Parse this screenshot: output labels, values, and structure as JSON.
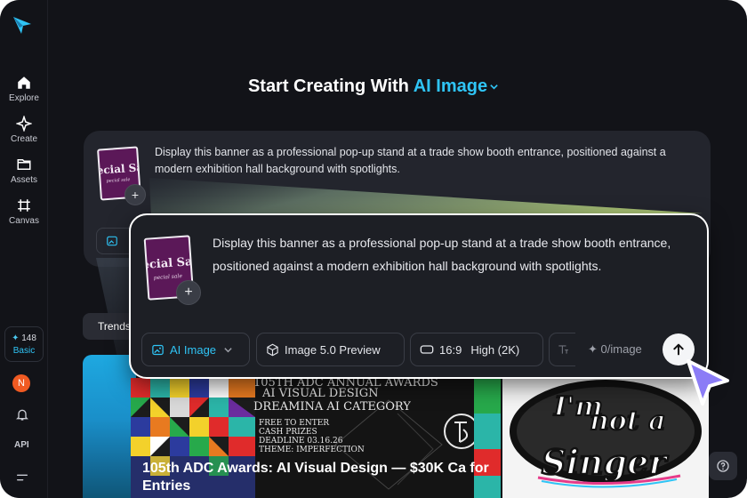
{
  "sidebar": {
    "items": [
      {
        "label": "Explore",
        "icon": "home-icon"
      },
      {
        "label": "Create",
        "icon": "sparkle-icon"
      },
      {
        "label": "Assets",
        "icon": "folder-icon"
      },
      {
        "label": "Canvas",
        "icon": "frame-icon"
      }
    ],
    "credits": "148",
    "plan": "Basic",
    "avatar_initial": "N",
    "api_label": "API"
  },
  "header": {
    "prefix": "Start Creating With",
    "mode": "AI Image"
  },
  "thumbnail": {
    "text_main": "ecial Sa",
    "text_sub": "pecial sale"
  },
  "background_card": {
    "prompt": "Display this banner as a professional pop-up stand at a trade show booth entrance, positioned against a modern exhibition hall background with spotlights."
  },
  "prompt_card": {
    "prompt": "Display this banner as a professional pop-up stand at a trade show booth entrance, positioned against a modern exhibition hall background with spotlights.",
    "toolbar": {
      "mode_label": "AI Image",
      "model_label": "Image 5.0 Preview",
      "ratio_label": "16:9",
      "quality_label": "High (2K)",
      "cost_label": "0/image"
    }
  },
  "trending": {
    "tab_label": "Trends"
  },
  "cards": {
    "adc": {
      "header_line1": "105TH ADC ANNUAL AWARDS",
      "header_line2": "AI VISUAL DESIGN",
      "header_line3": "DREAMINA AI CATEGORY",
      "details_line1": "FREE TO ENTER",
      "details_line2": "CASH PRIZES",
      "details_line3": "DEADLINE 03.16.26",
      "details_line4": "THEME: IMPERFECTION",
      "title": "105th ADC Awards: AI Visual Design — $30K Ca for Entries"
    },
    "sticker": {
      "line1": "I'm",
      "line2": "not a",
      "line3": "Singer"
    }
  },
  "colors": {
    "accent": "#2fc4f5",
    "background": "#121318",
    "card": "#23252d",
    "thumbnail": "#5b1858",
    "cursor": "#8b7cf6"
  }
}
